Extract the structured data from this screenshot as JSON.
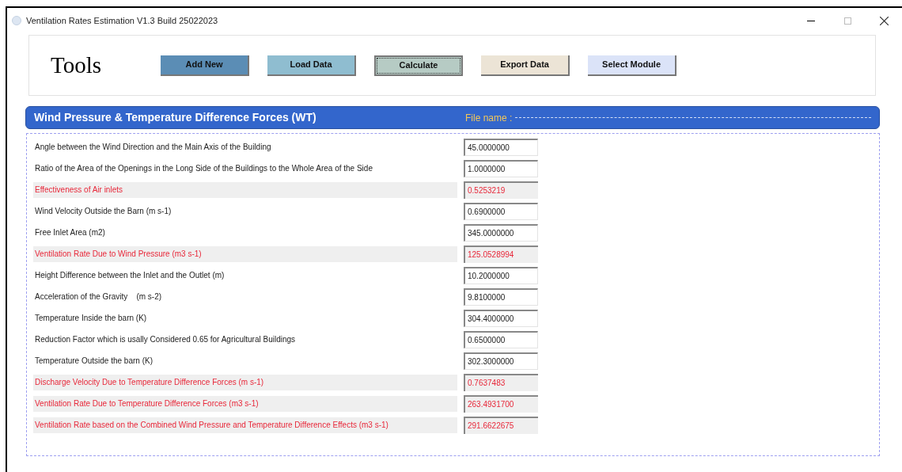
{
  "window": {
    "title": "Ventilation Rates Estimation V1.3 Build 25022023"
  },
  "toolbar": {
    "title": "Tools",
    "buttons": [
      {
        "label": "Add New",
        "color": "#5b8db5",
        "focused": false
      },
      {
        "label": "Load Data",
        "color": "#8fbdd0",
        "focused": false
      },
      {
        "label": "Calculate",
        "color": "#b6cbc4",
        "focused": true
      },
      {
        "label": "Export Data",
        "color": "#ece4d6",
        "focused": false
      },
      {
        "label": "Select Module",
        "color": "#dbe3f8",
        "focused": false
      }
    ]
  },
  "section": {
    "title": "Wind Pressure & Temperature Difference Forces (WT)",
    "file_name_label": "File name :"
  },
  "fields": [
    {
      "kind": "input",
      "label": "Angle between the Wind Direction and the Main Axis of the Building",
      "value": "45.0000000"
    },
    {
      "kind": "input",
      "label": "Ratio of the Area of the Openings in the Long Side of the Buildings to the Whole Area of the Side",
      "value": "1.0000000"
    },
    {
      "kind": "result",
      "label": "Effectiveness of Air inlets",
      "value": "0.5253219"
    },
    {
      "kind": "input",
      "label": "Wind Velocity Outside the Barn (m s-1)",
      "value": "0.6900000"
    },
    {
      "kind": "input",
      "label": "Free Inlet Area (m2)",
      "value": "345.0000000"
    },
    {
      "kind": "result",
      "label": "Ventilation Rate Due to Wind Pressure (m3 s-1)",
      "value": "125.0528994"
    },
    {
      "kind": "input",
      "label": "Height Difference between the Inlet and the Outlet (m)",
      "value": "10.2000000"
    },
    {
      "kind": "input",
      "label": "Acceleration of the Gravity    (m s-2)",
      "value": "9.8100000"
    },
    {
      "kind": "input",
      "label": "Temperature Inside the barn (K)",
      "value": "304.4000000"
    },
    {
      "kind": "input",
      "label": "Reduction Factor which is usally Considered 0.65 for Agricultural Buildings",
      "value": "0.6500000"
    },
    {
      "kind": "input",
      "label": "Temperature Outside the barn (K)",
      "value": "302.3000000"
    },
    {
      "kind": "result",
      "label": "Discharge Velocity Due to Temperature Difference Forces (m s-1)",
      "value": "0.7637483"
    },
    {
      "kind": "result",
      "label": "Ventilation Rate Due to Temperature Difference Forces (m3 s-1)",
      "value": "263.4931700"
    },
    {
      "kind": "result",
      "label": "Ventilation Rate based on the Combined Wind Pressure and Temperature Difference Effects (m3 s-1)",
      "value": "291.6622675"
    }
  ]
}
